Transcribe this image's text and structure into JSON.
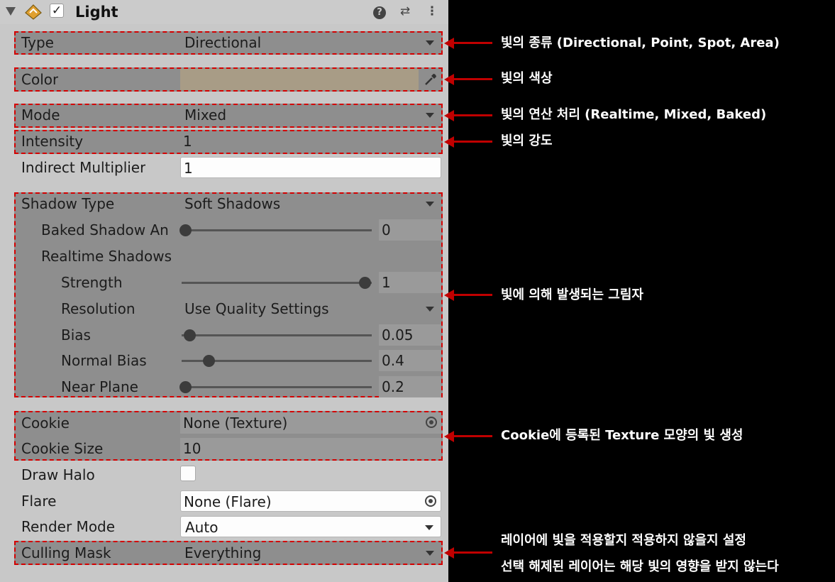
{
  "header": {
    "title": "Light",
    "enabled_checkmark": "✓",
    "help": "?",
    "preset": "⇄",
    "menu": "⋮"
  },
  "fields": {
    "type": {
      "label": "Type",
      "value": "Directional"
    },
    "color": {
      "label": "Color",
      "value_hex": "#a89c86"
    },
    "mode": {
      "label": "Mode",
      "value": "Mixed"
    },
    "intensity": {
      "label": "Intensity",
      "value": "1"
    },
    "indirect_multiplier": {
      "label": "Indirect Multiplier",
      "value": "1"
    },
    "shadow_type": {
      "label": "Shadow Type",
      "value": "Soft Shadows"
    },
    "baked_shadow_angle": {
      "label": "Baked Shadow An",
      "value": "0",
      "level": 0.0
    },
    "realtime_shadows": {
      "label": "Realtime Shadows"
    },
    "strength": {
      "label": "Strength",
      "value": "1",
      "level": 1.0
    },
    "resolution": {
      "label": "Resolution",
      "value": "Use Quality Settings"
    },
    "bias": {
      "label": "Bias",
      "value": "0.05",
      "level": 0.025
    },
    "normal_bias": {
      "label": "Normal Bias",
      "value": "0.4",
      "level": 0.13
    },
    "near_plane": {
      "label": "Near Plane",
      "value": "0.2",
      "level": 0.0
    },
    "cookie": {
      "label": "Cookie",
      "value": "None (Texture)"
    },
    "cookie_size": {
      "label": "Cookie Size",
      "value": "10"
    },
    "draw_halo": {
      "label": "Draw Halo",
      "checked": false
    },
    "flare": {
      "label": "Flare",
      "value": "None (Flare)"
    },
    "render_mode": {
      "label": "Render Mode",
      "value": "Auto"
    },
    "culling_mask": {
      "label": "Culling Mask",
      "value": "Everything"
    }
  },
  "annotations": {
    "type": "빛의 종류 (Directional, Point, Spot, Area)",
    "color": "빛의 색상",
    "mode": "빛의 연산 처리 (Realtime, Mixed, Baked)",
    "intensity": "빛의 강도",
    "shadow": "빛에 의해 발생되는 그림자",
    "cookie": "Cookie에 등록된 Texture 모양의 빛 생성",
    "culling_line1": "레이어에 빛을 적용할지 적용하지 않을지 설정",
    "culling_line2": "선택 해제된 레이어는 해당 빛의 영향을 받지 않는다"
  },
  "colors": {
    "annotation_border": "#d40000",
    "arrow": "#c00000",
    "highlight_bg": "#8e8e8e"
  }
}
